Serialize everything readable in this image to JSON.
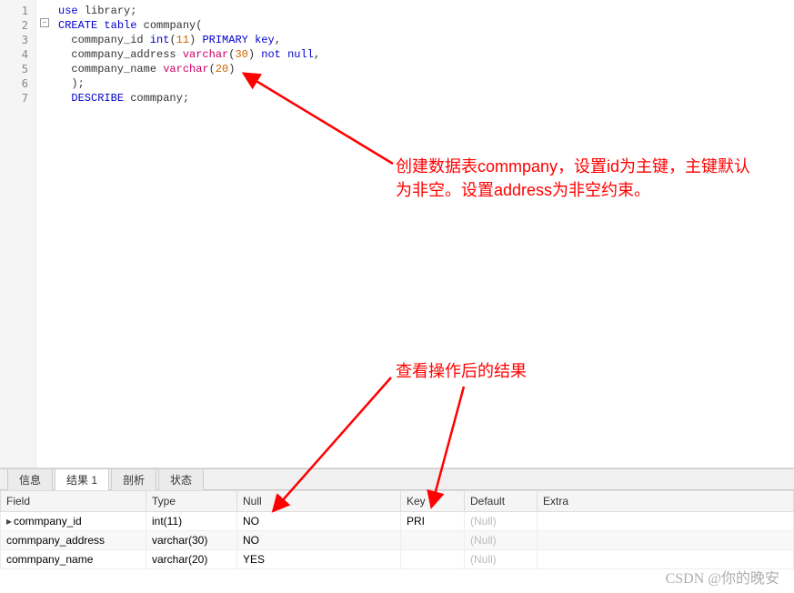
{
  "code": {
    "lines": [
      {
        "n": "1",
        "tokens": [
          {
            "t": "use",
            "c": "kw-blue"
          },
          {
            "t": " library;",
            "c": "txt"
          }
        ]
      },
      {
        "n": "2",
        "tokens": [
          {
            "t": "CREATE",
            "c": "kw-blue"
          },
          {
            "t": " ",
            "c": "txt"
          },
          {
            "t": "table",
            "c": "kw-blue"
          },
          {
            "t": " commpany(",
            "c": "txt"
          }
        ]
      },
      {
        "n": "3",
        "tokens": [
          {
            "t": "  commpany_id ",
            "c": "txt"
          },
          {
            "t": "int",
            "c": "kw-blue"
          },
          {
            "t": "(",
            "c": "txt"
          },
          {
            "t": "11",
            "c": "num"
          },
          {
            "t": ") ",
            "c": "txt"
          },
          {
            "t": "PRIMARY",
            "c": "kw-blue"
          },
          {
            "t": " ",
            "c": "txt"
          },
          {
            "t": "key",
            "c": "kw-blue"
          },
          {
            "t": ",",
            "c": "txt"
          }
        ]
      },
      {
        "n": "4",
        "tokens": [
          {
            "t": "  commpany_address ",
            "c": "txt"
          },
          {
            "t": "varchar",
            "c": "kw-pink"
          },
          {
            "t": "(",
            "c": "txt"
          },
          {
            "t": "30",
            "c": "num"
          },
          {
            "t": ") ",
            "c": "txt"
          },
          {
            "t": "not",
            "c": "kw-blue"
          },
          {
            "t": " ",
            "c": "txt"
          },
          {
            "t": "null",
            "c": "kw-blue"
          },
          {
            "t": ",",
            "c": "txt"
          }
        ]
      },
      {
        "n": "5",
        "tokens": [
          {
            "t": "  commpany_name ",
            "c": "txt"
          },
          {
            "t": "varchar",
            "c": "kw-pink"
          },
          {
            "t": "(",
            "c": "txt"
          },
          {
            "t": "20",
            "c": "num"
          },
          {
            "t": ")",
            "c": "txt"
          }
        ]
      },
      {
        "n": "6",
        "tokens": [
          {
            "t": "  );",
            "c": "txt"
          }
        ]
      },
      {
        "n": "7",
        "tokens": [
          {
            "t": "  ",
            "c": "txt"
          },
          {
            "t": "DESCRIBE",
            "c": "kw-blue"
          },
          {
            "t": " commpany;",
            "c": "txt"
          }
        ]
      }
    ]
  },
  "annotations": {
    "a1": "创建数据表commpany，设置id为主键，主键默认为非空。设置address为非空约束。",
    "a2": "查看操作后的结果"
  },
  "tabs": {
    "items": [
      "信息",
      "结果 1",
      "剖析",
      "状态"
    ],
    "active_index": 1
  },
  "results": {
    "headers": [
      "Field",
      "Type",
      "Null",
      "Key",
      "Default",
      "Extra"
    ],
    "rows": [
      {
        "Field": "commpany_id",
        "Type": "int(11)",
        "Null": "NO",
        "Key": "PRI",
        "Default": "(Null)",
        "Extra": ""
      },
      {
        "Field": "commpany_address",
        "Type": "varchar(30)",
        "Null": "NO",
        "Key": "",
        "Default": "(Null)",
        "Extra": ""
      },
      {
        "Field": "commpany_name",
        "Type": "varchar(20)",
        "Null": "YES",
        "Key": "",
        "Default": "(Null)",
        "Extra": ""
      }
    ]
  },
  "watermark": "CSDN @你的晚安",
  "fold_symbol": "−"
}
